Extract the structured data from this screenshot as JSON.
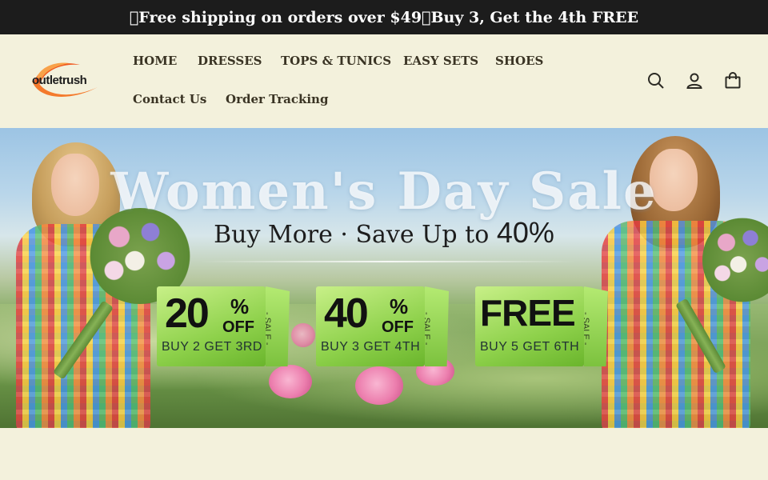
{
  "announcement": "\u0000Free shipping on orders over $49\u0000Buy 3, Get the 4th FREE",
  "logo": {
    "text": "outletrush"
  },
  "nav": {
    "items": [
      "HOME",
      "DRESSES",
      "TOPS & TUNICS",
      "EASY SETS",
      "SHOES",
      "Contact Us",
      "Order Tracking"
    ]
  },
  "header_icons": [
    "search-icon",
    "account-icon",
    "cart-icon"
  ],
  "hero": {
    "title": "Women's Day Sale",
    "subtitle_prefix": "Buy More · Save Up to ",
    "subtitle_value": "40%",
    "offers": [
      {
        "amount": "20",
        "pct": "%",
        "off": "OFF",
        "caption": "BUY 2 GET 3RD",
        "tab": "- SALE -"
      },
      {
        "amount": "40",
        "pct": "%",
        "off": "OFF",
        "caption": "BUY 3 GET 4TH",
        "tab": "- SALE -"
      },
      {
        "amount": "FREE",
        "caption": "BUY 5 GET 6TH",
        "tab": "- SALE -"
      }
    ]
  },
  "colors": {
    "announcement_bg": "#1c1c1c",
    "page_bg": "#f3f1dc",
    "badge_green": "#8ed14b",
    "logo_orange": "#f0581f"
  }
}
